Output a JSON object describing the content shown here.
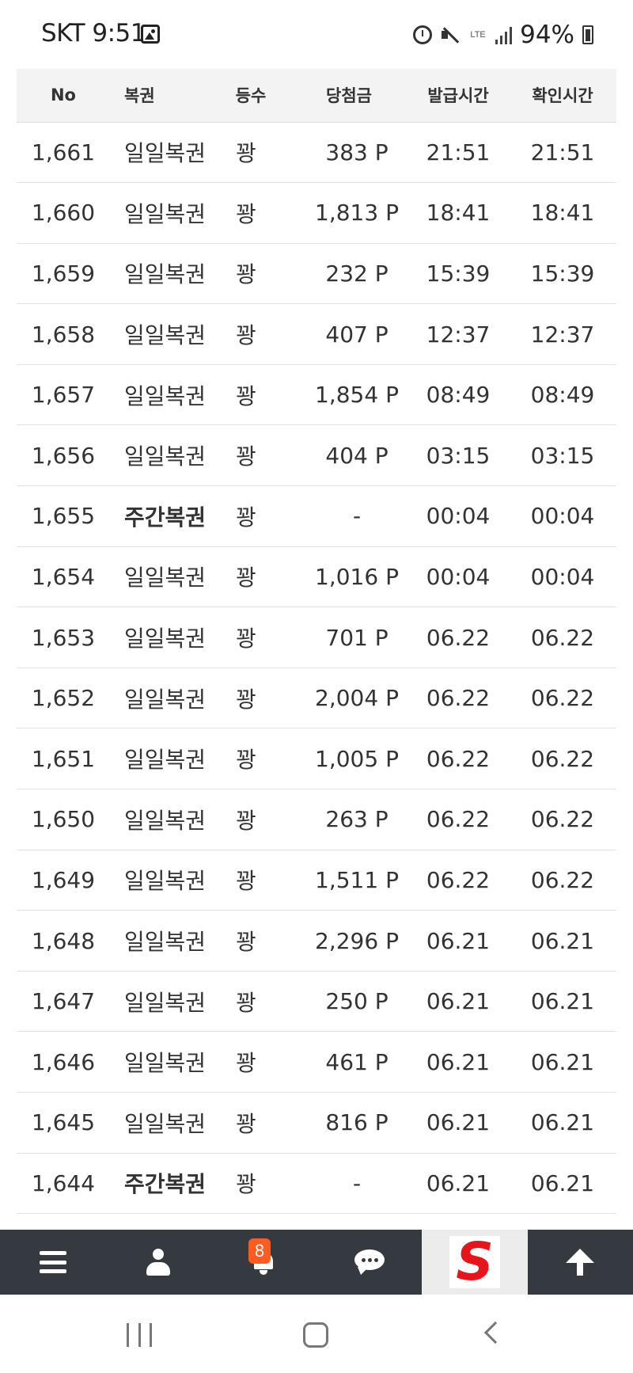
{
  "status_bar": {
    "carrier_time": "SKT 9:51",
    "lte": "LTE",
    "battery": "94%"
  },
  "table": {
    "headers": [
      "No",
      "복권",
      "등수",
      "당첨금",
      "발급시간",
      "확인시간"
    ],
    "rows": [
      {
        "no": "1,661",
        "lottery": "일일복권",
        "rank": "꽝",
        "prize": "383 P",
        "issued": "21:51",
        "checked": "21:51",
        "bold": false
      },
      {
        "no": "1,660",
        "lottery": "일일복권",
        "rank": "꽝",
        "prize": "1,813 P",
        "issued": "18:41",
        "checked": "18:41",
        "bold": false
      },
      {
        "no": "1,659",
        "lottery": "일일복권",
        "rank": "꽝",
        "prize": "232 P",
        "issued": "15:39",
        "checked": "15:39",
        "bold": false
      },
      {
        "no": "1,658",
        "lottery": "일일복권",
        "rank": "꽝",
        "prize": "407 P",
        "issued": "12:37",
        "checked": "12:37",
        "bold": false
      },
      {
        "no": "1,657",
        "lottery": "일일복권",
        "rank": "꽝",
        "prize": "1,854 P",
        "issued": "08:49",
        "checked": "08:49",
        "bold": false
      },
      {
        "no": "1,656",
        "lottery": "일일복권",
        "rank": "꽝",
        "prize": "404 P",
        "issued": "03:15",
        "checked": "03:15",
        "bold": false
      },
      {
        "no": "1,655",
        "lottery": "주간복권",
        "rank": "꽝",
        "prize": "-",
        "issued": "00:04",
        "checked": "00:04",
        "bold": true
      },
      {
        "no": "1,654",
        "lottery": "일일복권",
        "rank": "꽝",
        "prize": "1,016 P",
        "issued": "00:04",
        "checked": "00:04",
        "bold": false
      },
      {
        "no": "1,653",
        "lottery": "일일복권",
        "rank": "꽝",
        "prize": "701 P",
        "issued": "06.22",
        "checked": "06.22",
        "bold": false
      },
      {
        "no": "1,652",
        "lottery": "일일복권",
        "rank": "꽝",
        "prize": "2,004 P",
        "issued": "06.22",
        "checked": "06.22",
        "bold": false
      },
      {
        "no": "1,651",
        "lottery": "일일복권",
        "rank": "꽝",
        "prize": "1,005 P",
        "issued": "06.22",
        "checked": "06.22",
        "bold": false
      },
      {
        "no": "1,650",
        "lottery": "일일복권",
        "rank": "꽝",
        "prize": "263 P",
        "issued": "06.22",
        "checked": "06.22",
        "bold": false
      },
      {
        "no": "1,649",
        "lottery": "일일복권",
        "rank": "꽝",
        "prize": "1,511 P",
        "issued": "06.22",
        "checked": "06.22",
        "bold": false
      },
      {
        "no": "1,648",
        "lottery": "일일복권",
        "rank": "꽝",
        "prize": "2,296 P",
        "issued": "06.21",
        "checked": "06.21",
        "bold": false
      },
      {
        "no": "1,647",
        "lottery": "일일복권",
        "rank": "꽝",
        "prize": "250 P",
        "issued": "06.21",
        "checked": "06.21",
        "bold": false
      },
      {
        "no": "1,646",
        "lottery": "일일복권",
        "rank": "꽝",
        "prize": "461 P",
        "issued": "06.21",
        "checked": "06.21",
        "bold": false
      },
      {
        "no": "1,645",
        "lottery": "일일복권",
        "rank": "꽝",
        "prize": "816 P",
        "issued": "06.21",
        "checked": "06.21",
        "bold": false
      },
      {
        "no": "1,644",
        "lottery": "주간복권",
        "rank": "꽝",
        "prize": "-",
        "issued": "06.21",
        "checked": "06.21",
        "bold": true
      }
    ]
  },
  "bottom_nav": {
    "items": [
      {
        "icon": "menu-icon"
      },
      {
        "icon": "user-icon"
      },
      {
        "icon": "bell-icon",
        "badge": "8"
      },
      {
        "icon": "chat-icon"
      },
      {
        "icon": "logo-s",
        "label": "S"
      },
      {
        "icon": "arrow-up-icon"
      }
    ]
  },
  "colors": {
    "nav_background": "#343a40",
    "badge": "#ff5a1f",
    "logo_red": "#e8141b",
    "header_background": "#f3f3f3"
  }
}
